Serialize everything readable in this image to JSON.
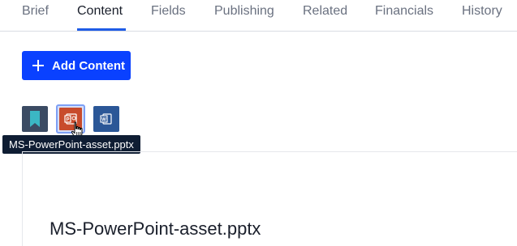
{
  "tabs": [
    {
      "label": "Brief",
      "active": false
    },
    {
      "label": "Content",
      "active": true
    },
    {
      "label": "Fields",
      "active": false
    },
    {
      "label": "Publishing",
      "active": false
    },
    {
      "label": "Related",
      "active": false
    },
    {
      "label": "Financials",
      "active": false
    },
    {
      "label": "History",
      "active": false
    }
  ],
  "toolbar": {
    "add_content_label": "Add Content"
  },
  "assets": [
    {
      "icon": "bookmark-icon",
      "color": "#3b4b63"
    },
    {
      "icon": "powerpoint-file-icon",
      "color": "#c84b2c",
      "selected": true
    },
    {
      "icon": "word-file-icon",
      "color": "#2b5797"
    }
  ],
  "tooltip": {
    "text": "MS-PowerPoint-asset.pptx"
  },
  "preview": {
    "title": "MS-PowerPoint-asset.pptx"
  },
  "colors": {
    "accent": "#0a41ff",
    "tab_underline": "#1f5ce6",
    "tooltip_bg": "#0f1d33"
  }
}
